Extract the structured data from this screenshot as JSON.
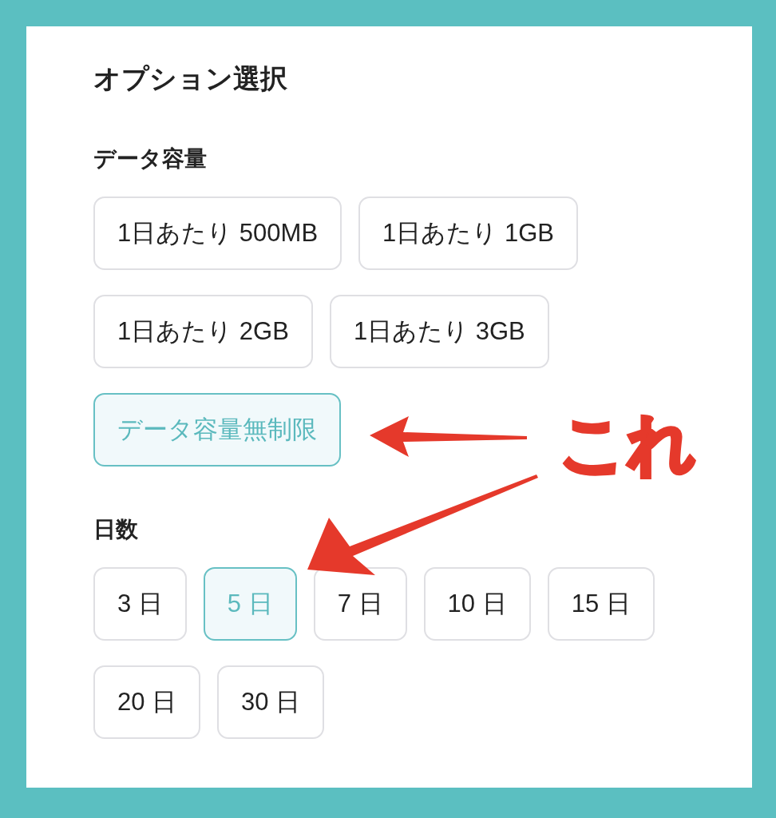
{
  "title": "オプション選択",
  "sections": [
    {
      "heading": "データ容量",
      "options": [
        {
          "label": "1日あたり 500MB",
          "selected": false
        },
        {
          "label": "1日あたり 1GB",
          "selected": false
        },
        {
          "label": "1日あたり 2GB",
          "selected": false
        },
        {
          "label": "1日あたり 3GB",
          "selected": false
        },
        {
          "label": "データ容量無制限",
          "selected": true
        }
      ]
    },
    {
      "heading": "日数",
      "options": [
        {
          "label": "3 日",
          "selected": false
        },
        {
          "label": "5 日",
          "selected": true
        },
        {
          "label": "7 日",
          "selected": false
        },
        {
          "label": "10 日",
          "selected": false
        },
        {
          "label": "15 日",
          "selected": false
        },
        {
          "label": "20 日",
          "selected": false
        },
        {
          "label": "30 日",
          "selected": false
        }
      ]
    }
  ],
  "annotation": {
    "text": "これ"
  }
}
